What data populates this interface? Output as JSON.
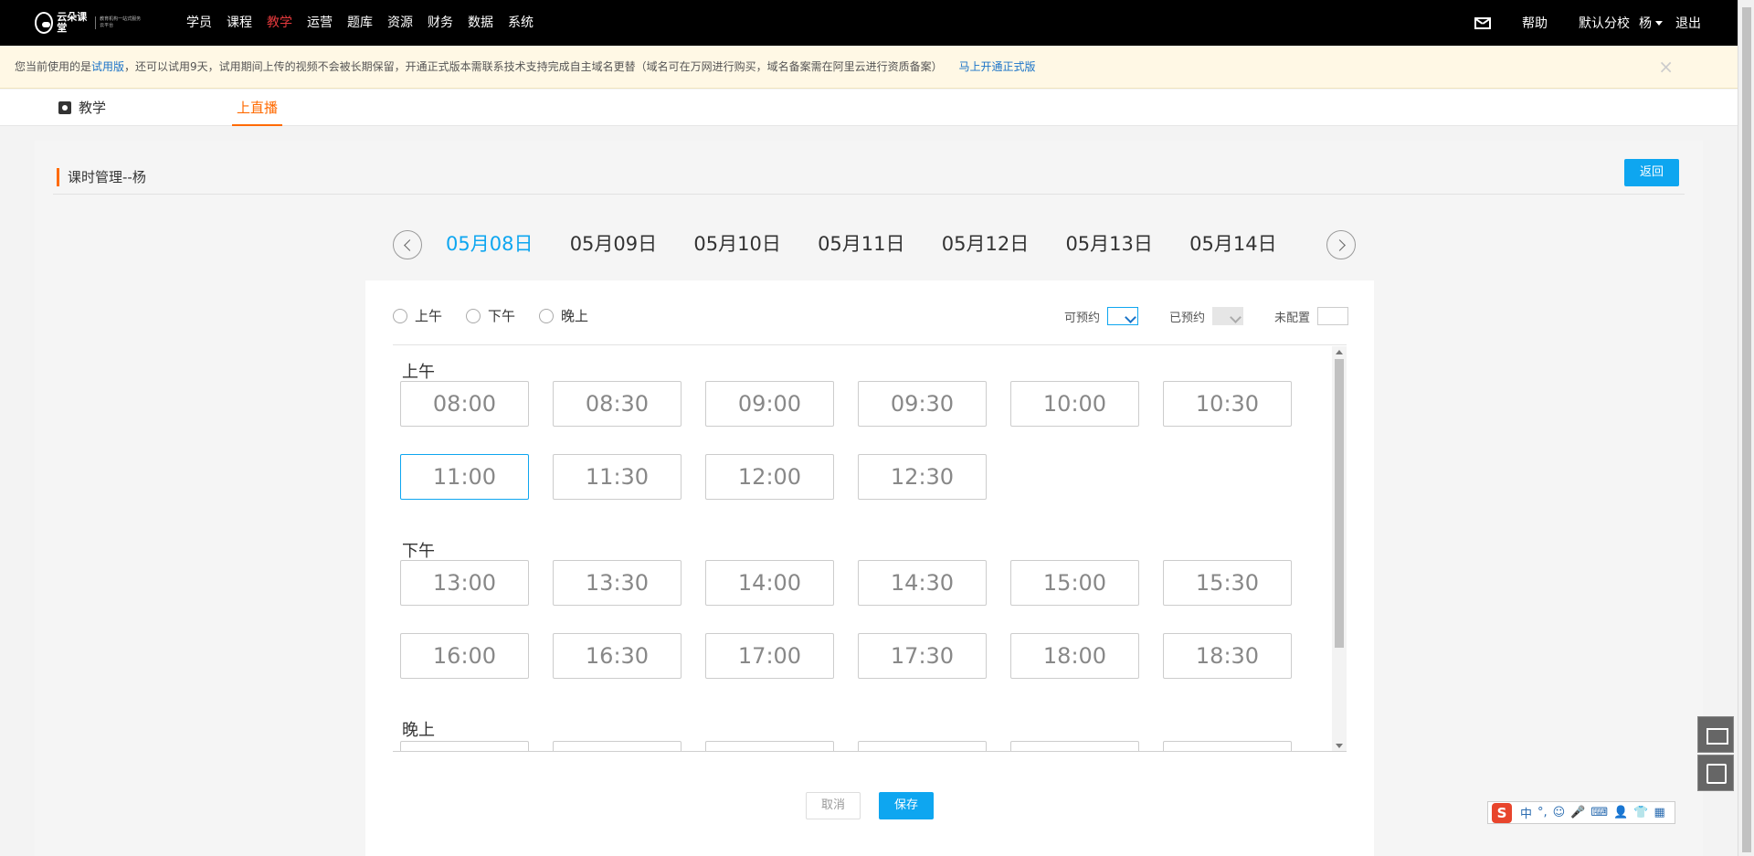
{
  "brand": {
    "logo_text": "云朵课堂",
    "logo_sub": "教育机构一站式服务云平台"
  },
  "nav": {
    "items": [
      "学员",
      "课程",
      "教学",
      "运营",
      "题库",
      "资源",
      "财务",
      "数据",
      "系统"
    ],
    "active": "教学"
  },
  "top_right": {
    "help": "帮助",
    "branch": "默认分校",
    "user": "杨",
    "logout": "退出"
  },
  "notice": {
    "text_1": "您当前使用的是",
    "trial_link": "试用版",
    "text_2": "，还可以试用9天，试用期间上传的视频不会被长期保留，开通正式版本需联系技术支持完成自主域名更替（域名可在万网进行购买，域名备案需在阿里云进行资质备案）",
    "upgrade_link": "马上开通正式版",
    "close": "×"
  },
  "subtabs": {
    "home": "教学",
    "live": "上直播"
  },
  "page": {
    "title": "课时管理--杨",
    "back": "返回"
  },
  "dates": {
    "items": [
      "05月08日",
      "05月09日",
      "05月10日",
      "05月11日",
      "05月12日",
      "05月13日",
      "05月14日"
    ],
    "active": "05月08日"
  },
  "periods": [
    "上午",
    "下午",
    "晚上"
  ],
  "legend": {
    "available": "可预约",
    "booked": "已预约",
    "unconfigured": "未配置"
  },
  "sections": {
    "morning": {
      "title": "上午",
      "slots": [
        "08:00",
        "08:30",
        "09:00",
        "09:30",
        "10:00",
        "10:30",
        "11:00",
        "11:30",
        "12:00",
        "12:30"
      ],
      "selected": "11:00"
    },
    "afternoon": {
      "title": "下午",
      "slots": [
        "13:00",
        "13:30",
        "14:00",
        "14:30",
        "15:00",
        "15:30",
        "16:00",
        "16:30",
        "17:00",
        "17:30",
        "18:00",
        "18:30"
      ]
    },
    "evening": {
      "title": "晚上"
    }
  },
  "actions": {
    "cancel": "取消",
    "save": "保存"
  },
  "ime": {
    "logo": "S",
    "lang": "中",
    "punct": "°,",
    "tools": [
      "☺",
      "🎤",
      "⌨",
      "👤",
      "👕",
      "▦"
    ]
  }
}
